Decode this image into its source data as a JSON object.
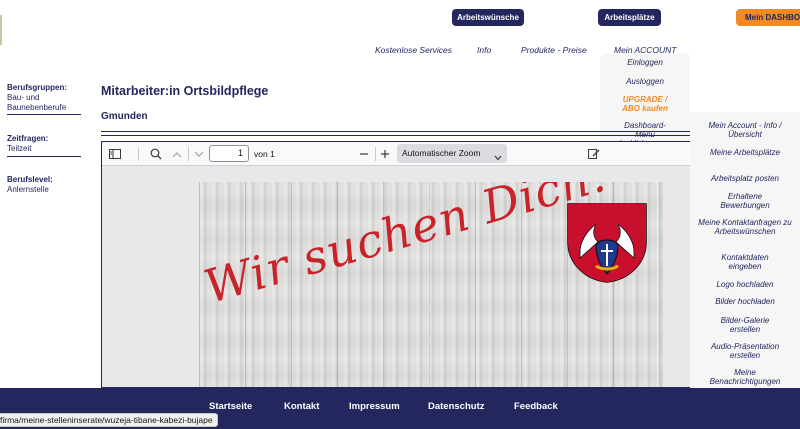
{
  "header": {
    "buttons": [
      {
        "label": "Arbeitswünsche"
      },
      {
        "label": "Arbeitsplätze"
      },
      {
        "label": "Mein DASHBOARD"
      }
    ],
    "nav": [
      {
        "label": "Kostenlose Services"
      },
      {
        "label": "Info"
      },
      {
        "label": "Produkte - Preise"
      },
      {
        "label": "Mein ACCOUNT"
      }
    ],
    "account_menu": [
      {
        "label": "Einloggen"
      },
      {
        "label": "Ausloggen"
      },
      {
        "label": "UPGRADE / ABO kaufen"
      },
      {
        "label": "Dashboard-Menü (anklicken zum fixieren) »"
      }
    ]
  },
  "sidebar": {
    "groups": [
      {
        "label": "Berufsgruppen:",
        "value": "Bau- und Baunebenberufe"
      },
      {
        "label": "Zeitfragen:",
        "value": "Teilzeit"
      },
      {
        "label": "Berufslevel:",
        "value": "Anlernstelle"
      }
    ]
  },
  "main": {
    "title": "Mitarbeiter:in Ortsbildpflege",
    "location": "Gmunden"
  },
  "pdf_viewer": {
    "page_number": "1",
    "page_total": "von 1",
    "zoom": "Automatischer Zoom",
    "slogan": "Wir suchen Dich!"
  },
  "dashboard_menu": [
    {
      "label": "Mein Account - Info / Übersicht"
    },
    {
      "label": "Meine Arbeitsplätze"
    },
    {
      "label": "Arbeitsplatz posten"
    },
    {
      "label": "Erhaltene Bewerbungen"
    },
    {
      "label": "Meine Kontaktanfragen zu Arbeitswünschen"
    },
    {
      "label": "Kontaktdaten eingeben"
    },
    {
      "label": "Logo hochladen"
    },
    {
      "label": "Bilder hochladen"
    },
    {
      "label": "Bilder-Galerie erstellen"
    },
    {
      "label": "Audio-Präsentation erstellen"
    },
    {
      "label": "Meine Benachrichtigungen"
    }
  ],
  "footer": {
    "links": [
      {
        "label": "Startseite"
      },
      {
        "label": "Kontakt"
      },
      {
        "label": "Impressum"
      },
      {
        "label": "Datenschutz"
      },
      {
        "label": "Feedback"
      }
    ]
  },
  "status_bar": {
    "url": "firma/meine-stelleninserate/wuzeja-tibane-kabezi-bujape"
  },
  "colors": {
    "brand_navy": "#23275e",
    "accent_orange": "#f08a24",
    "slogan_red": "#c9232a"
  }
}
